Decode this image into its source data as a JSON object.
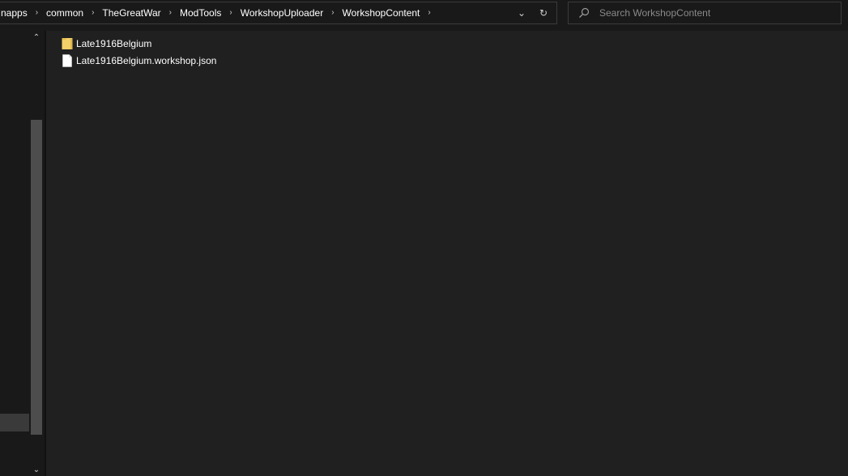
{
  "breadcrumb": {
    "items": [
      {
        "label": "napps"
      },
      {
        "label": "common"
      },
      {
        "label": "TheGreatWar"
      },
      {
        "label": "ModTools"
      },
      {
        "label": "WorkshopUploader"
      },
      {
        "label": "WorkshopContent"
      }
    ],
    "separator": "›",
    "trailing_separator": "›"
  },
  "address_bar": {
    "dropdown_icon": "chevron-down-icon",
    "refresh_icon": "refresh-icon",
    "dropdown_glyph": "⌄",
    "refresh_glyph": "↻"
  },
  "search": {
    "placeholder": "Search WorkshopContent",
    "value": ""
  },
  "files": [
    {
      "name": "Late1916Belgium",
      "type": "folder",
      "icon": "folder-icon"
    },
    {
      "name": "Late1916Belgium.workshop.json",
      "type": "file",
      "icon": "document-icon"
    }
  ],
  "navpane": {
    "scroll_up_glyph": "⌃",
    "scroll_down_glyph": "⌄"
  },
  "colors": {
    "background": "#191919",
    "content_background": "#202020",
    "border": "#3b3b3b",
    "folder_yellow": "#f4d06a",
    "scroll_thumb": "#4d4d4d"
  }
}
